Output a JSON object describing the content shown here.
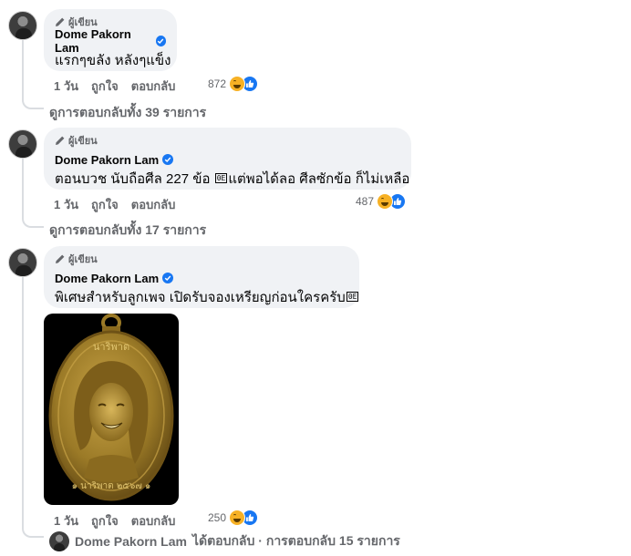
{
  "comments": [
    {
      "badge": "ผู้เขียน",
      "name": "Dome Pakorn Lam",
      "text": "แรกๆขลัง หลังๆแข็ง",
      "time": "1 วัน",
      "like_label": "ถูกใจ",
      "reply_label": "ตอบกลับ",
      "reaction_count": "872",
      "view_replies": "ดูการตอบกลับทั้ง 39 รายการ"
    },
    {
      "badge": "ผู้เขียน",
      "name": "Dome Pakorn Lam",
      "text_before": "ตอนบวช นับถือศีล 227 ข้อ",
      "glyph": "0E",
      "text_after": "แต่พอได้ลอ ศีลซักข้อ ก็ไม่เหลือ",
      "time": "1 วัน",
      "like_label": "ถูกใจ",
      "reply_label": "ตอบกลับ",
      "reaction_count": "487",
      "view_replies": "ดูการตอบกลับทั้ง 17 รายการ"
    },
    {
      "badge": "ผู้เขียน",
      "name": "Dome Pakorn Lam",
      "text_before": "พิเศษสำหรับลูกเพจ เปิดรับจองเหรียญก่อนใครครับ",
      "glyph": "0E",
      "medal_text_top": "นาริพาต",
      "medal_text_bottom": "๑ นาริพาต ๒๕๖๗ ๑",
      "time": "1 วัน",
      "like_label": "ถูกใจ",
      "reply_label": "ตอบกลับ",
      "reaction_count": "250",
      "reply_author": "Dome Pakorn Lam",
      "reply_summary": "ได้ตอบกลับ · การตอบกลับ 15 รายการ"
    }
  ],
  "colors": {
    "bubble": "#f0f2f5",
    "secondary_text": "#65676b",
    "verified": "#1877f2",
    "haha": "#f7b125",
    "medal_gold": "#b8902e"
  },
  "icons": [
    "pencil-icon",
    "verified-icon",
    "haha-reaction-icon",
    "like-reaction-icon"
  ]
}
